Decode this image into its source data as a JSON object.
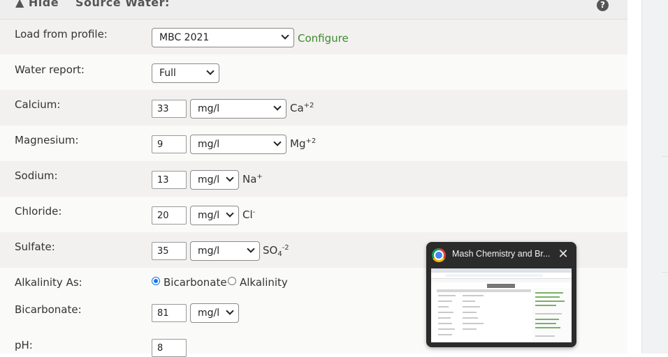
{
  "section": {
    "toggle_label": "▲ Hide",
    "title": "Source Water:",
    "help_icon": "question-icon"
  },
  "load_profile": {
    "label": "Load from profile:",
    "selected": "MBC 2021",
    "configure_link": "Configure"
  },
  "water_report": {
    "label": "Water report:",
    "selected": "Full"
  },
  "ions": [
    {
      "label": "Calcium:",
      "value": "33",
      "unit": "mg/l",
      "symbol": "Ca",
      "charge": "+2"
    },
    {
      "label": "Magnesium:",
      "value": "9",
      "unit": "mg/l",
      "symbol": "Mg",
      "charge": "+2"
    },
    {
      "label": "Sodium:",
      "value": "13",
      "unit": "mg/l",
      "symbol": "Na",
      "charge": "+"
    },
    {
      "label": "Chloride:",
      "value": "20",
      "unit": "mg/l",
      "symbol": "Cl",
      "charge": "-"
    },
    {
      "label": "Sulfate:",
      "value": "35",
      "unit": "mg/l",
      "symbol": "SO",
      "subscript": "4",
      "charge": "-2"
    }
  ],
  "alkalinity": {
    "label": "Alkalinity As:",
    "options": [
      "Bicarbonate",
      "Alkalinity"
    ],
    "selected": "Bicarbonate"
  },
  "bicarbonate": {
    "label": "Bicarbonate:",
    "value": "81",
    "unit": "mg/l"
  },
  "ph": {
    "label": "pH:",
    "value": "8"
  },
  "taskbar_preview": {
    "title": "Mash Chemistry and Br...",
    "app_icon": "chrome-icon",
    "close_icon": "close-icon"
  },
  "colors": {
    "link_green": "#3c8a2e",
    "radio_blue": "#1a73e8",
    "row_shade": "#f2f1ef"
  }
}
